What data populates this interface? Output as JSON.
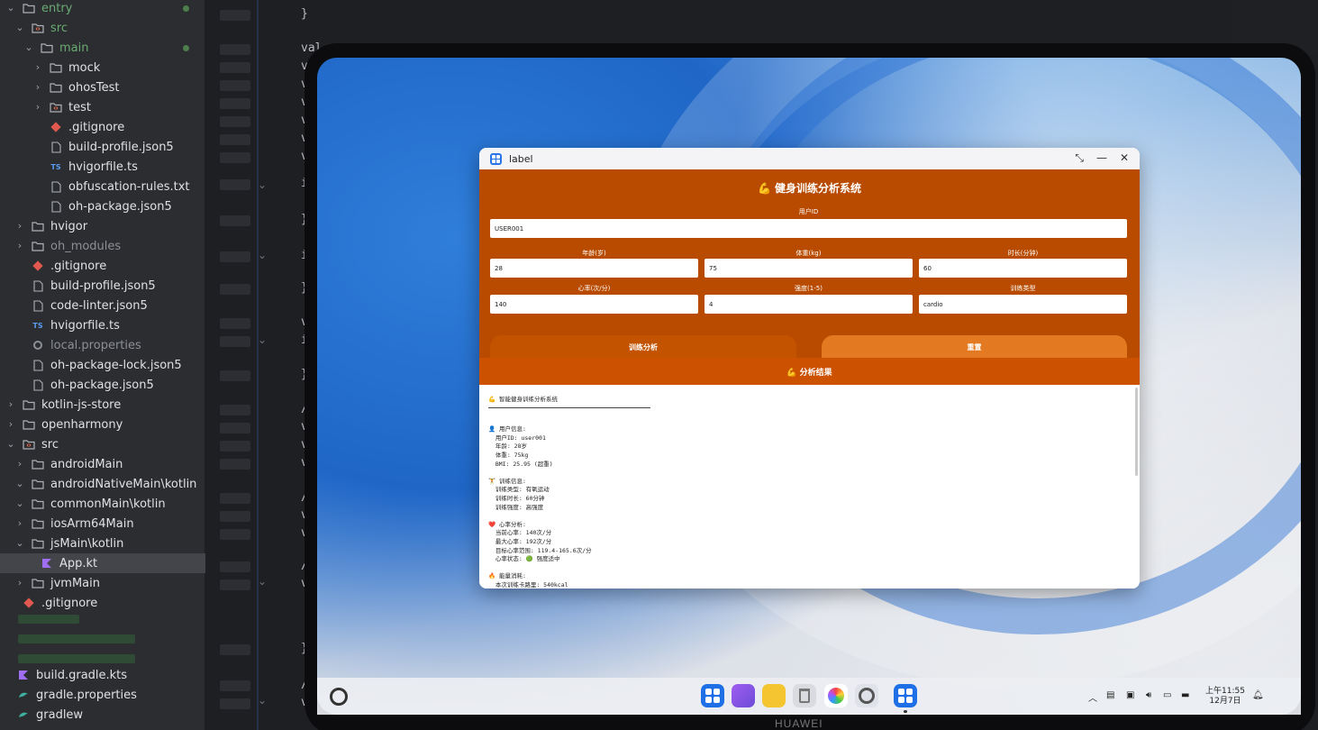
{
  "ide": {
    "tree": [
      {
        "label": "entry",
        "kind": "folder",
        "open": true,
        "indent": 0,
        "color": "green",
        "dot": true
      },
      {
        "label": "src",
        "kind": "srcfolder",
        "open": true,
        "indent": 1,
        "color": "green"
      },
      {
        "label": "main",
        "kind": "folder",
        "open": true,
        "indent": 2,
        "color": "green",
        "dot": true
      },
      {
        "label": "mock",
        "kind": "folder",
        "open": false,
        "indent": 3
      },
      {
        "label": "ohosTest",
        "kind": "folder",
        "open": false,
        "indent": 3
      },
      {
        "label": "test",
        "kind": "srcfolder",
        "open": false,
        "indent": 3
      },
      {
        "label": ".gitignore",
        "kind": "git",
        "indent": 3
      },
      {
        "label": "build-profile.json5",
        "kind": "file",
        "indent": 3
      },
      {
        "label": "hvigorfile.ts",
        "kind": "ts",
        "indent": 3
      },
      {
        "label": "obfuscation-rules.txt",
        "kind": "file",
        "indent": 3
      },
      {
        "label": "oh-package.json5",
        "kind": "file",
        "indent": 3
      },
      {
        "label": "hvigor",
        "kind": "folder",
        "open": false,
        "indent": 1
      },
      {
        "label": "oh_modules",
        "kind": "folder",
        "open": false,
        "indent": 1,
        "color": "dim"
      },
      {
        "label": ".gitignore",
        "kind": "git",
        "indent": 1
      },
      {
        "label": "build-profile.json5",
        "kind": "file",
        "indent": 1
      },
      {
        "label": "code-linter.json5",
        "kind": "file",
        "indent": 1
      },
      {
        "label": "hvigorfile.ts",
        "kind": "ts",
        "indent": 1
      },
      {
        "label": "local.properties",
        "kind": "props",
        "indent": 1,
        "color": "dim"
      },
      {
        "label": "oh-package-lock.json5",
        "kind": "file",
        "indent": 1
      },
      {
        "label": "oh-package.json5",
        "kind": "file",
        "indent": 1
      },
      {
        "label": "kotlin-js-store",
        "kind": "folder",
        "open": false,
        "indent": 0
      },
      {
        "label": "openharmony",
        "kind": "folder",
        "open": false,
        "indent": 0
      },
      {
        "label": "src",
        "kind": "srcfolder",
        "open": true,
        "indent": 0
      },
      {
        "label": "androidMain",
        "kind": "folder",
        "open": false,
        "indent": 1
      },
      {
        "label": "androidNativeMain\\kotlin",
        "kind": "folder",
        "open": true,
        "indent": 1
      },
      {
        "label": "commonMain\\kotlin",
        "kind": "folder",
        "open": true,
        "indent": 1
      },
      {
        "label": "iosArm64Main",
        "kind": "folder",
        "open": false,
        "indent": 1
      },
      {
        "label": "jsMain\\kotlin",
        "kind": "folder",
        "open": true,
        "indent": 1
      },
      {
        "label": "App.kt",
        "kind": "kotlin",
        "indent": 2,
        "selected": true
      },
      {
        "label": "jvmMain",
        "kind": "folder",
        "open": false,
        "indent": 1
      },
      {
        "label": ".gitignore",
        "kind": "git",
        "indent": 0
      }
    ],
    "tree_bottom": [
      {
        "label": "build.gradle.kts",
        "kind": "kotlin"
      },
      {
        "label": "gradle.properties",
        "kind": "gradle"
      },
      {
        "label": "gradlew",
        "kind": "gradle"
      }
    ],
    "code_lines": [
      {
        "text": "}"
      },
      {
        "text": "val"
      },
      {
        "text": "v"
      },
      {
        "text": "v"
      },
      {
        "text": "v"
      },
      {
        "text": "v"
      },
      {
        "text": "v"
      },
      {
        "text": "v"
      },
      {
        "text": "i"
      },
      {
        "text": "}"
      },
      {
        "text": "i"
      },
      {
        "text": "}"
      },
      {
        "text": "v"
      },
      {
        "text": "i"
      },
      {
        "text": "}"
      },
      {
        "text": "/"
      },
      {
        "text": "v"
      },
      {
        "text": "v"
      },
      {
        "text": "v"
      },
      {
        "text": "/"
      },
      {
        "text": "v"
      },
      {
        "text": "v"
      },
      {
        "text": "/"
      },
      {
        "text": "v"
      },
      {
        "text": "}"
      },
      {
        "text": "/"
      },
      {
        "text": "v"
      }
    ]
  },
  "app": {
    "window_title": "label",
    "heading": "💪 健身训练分析系统",
    "user_id_label": "用户ID",
    "user_id_value": "USER001",
    "fields_row1": [
      {
        "label": "年龄(岁)",
        "value": "28"
      },
      {
        "label": "体重(kg)",
        "value": "75"
      },
      {
        "label": "时长(分钟)",
        "value": "60"
      }
    ],
    "fields_row2": [
      {
        "label": "心率(次/分)",
        "value": "140"
      },
      {
        "label": "强度(1-5)",
        "value": "4"
      },
      {
        "label": "训练类型",
        "value": "cardio"
      }
    ],
    "analyze_button": "训练分析",
    "reset_button": "重置",
    "result_header": "💪 分析结果",
    "result_text": "💪 智能健身训练分析系统\n\n👤 用户信息:\n  用户ID: user001\n  年龄: 28岁\n  体重: 75kg\n  BMI: 25.95 (超重)\n\n🏋 训练信息:\n  训练类型: 有氧运动\n  训练时长: 60分钟\n  训练强度: 高强度\n\n❤️ 心率分析:\n  当前心率: 140次/分\n  最大心率: 192次/分\n  目标心率范围: 119.4-165.6次/分\n  心率状态: 🟢 强度适中\n\n🔥 能量消耗:\n  本次训练卡路里: 540kcal"
  },
  "device": {
    "brand": "HUAWEI",
    "clock_time": "上午11:55",
    "clock_date": "12月7日",
    "dock_apps": [
      "app-grid-icon",
      "multitask-icon",
      "files-icon",
      "trash-icon",
      "gallery-icon",
      "settings-icon",
      "label-app-icon"
    ]
  },
  "colors": {
    "accent_orange": "#b84b00",
    "result_bar": "#cc5100",
    "reset_btn": "#e37a21"
  }
}
